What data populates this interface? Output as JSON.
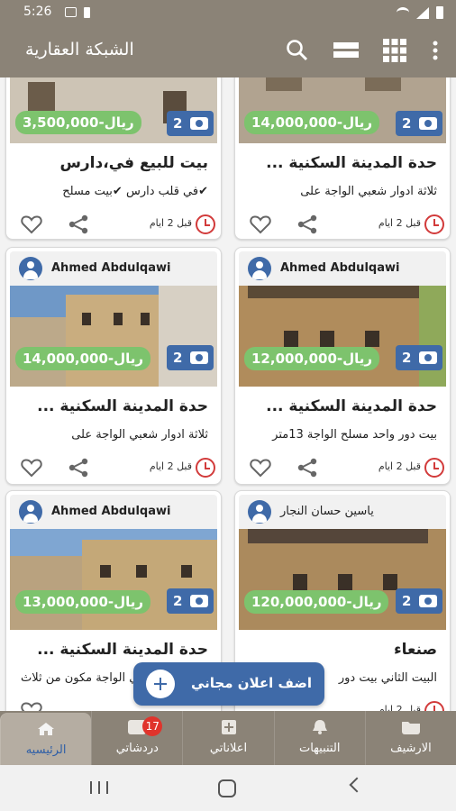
{
  "status_bar": {
    "time": "5:26"
  },
  "app_bar": {
    "title": "الشبكة العقارية",
    "icons": [
      "search-icon",
      "list-view-icon",
      "grid-view-icon",
      "more-vert-icon"
    ]
  },
  "colors": {
    "primary": "#8b8377",
    "accent": "#3f6aa8",
    "price": "#7dc36d",
    "alert": "#d23b3b"
  },
  "cards": [
    {
      "price": "3,500,000-ريال",
      "photos": "2",
      "title": "بيت للبيع في،دارس",
      "desc": "✔في قلب دارس ✔بيت مسلح",
      "time": "قبل 2 ايام"
    },
    {
      "price": "14,000,000-ريال",
      "photos": "2",
      "title": "حدة المدينة السكنية ...",
      "desc": "ثلاثة ادوار شعبي الواجة على",
      "time": "قبل 2 ايام"
    },
    {
      "owner": "Ahmed Abdulqawi",
      "price": "14,000,000-ريال",
      "photos": "2",
      "title": "حدة المدينة السكنية ...",
      "desc": "ثلاثة ادوار شعبي الواجة على",
      "time": "قبل 2 ايام"
    },
    {
      "owner": "Ahmed Abdulqawi",
      "price": "12,000,000-ريال",
      "photos": "2",
      "title": "حدة المدينة السكنية ...",
      "desc": "بيت دور واحد مسلح الواجة 13متر",
      "time": "قبل 2 ايام"
    },
    {
      "owner": "Ahmed Abdulqawi",
      "price": "13,000,000-ريال",
      "photos": "2",
      "title": "حدة المدينة السكنية ...",
      "desc": "ثلاثة ادوار شعبي الواجة مكون من ثلاث",
      "time": ""
    },
    {
      "owner": "ياسين حسان النجار",
      "price": "120,000,000-ريال",
      "photos": "2",
      "title": "صنعاء",
      "desc": "البيت الثاني بيت دور",
      "time": "قبل 2 ايام"
    }
  ],
  "fab": {
    "label": "اضف اعلان مجاني"
  },
  "bottom_nav": [
    {
      "label": "الرئيسيه",
      "icon": "home-icon",
      "active": true
    },
    {
      "label": "دردشاتي",
      "icon": "chat-icon",
      "badge": "17"
    },
    {
      "label": "اعلاناتي",
      "icon": "add-box-icon"
    },
    {
      "label": "التنبيهات",
      "icon": "bell-icon"
    },
    {
      "label": "الارشيف",
      "icon": "folder-icon"
    }
  ]
}
